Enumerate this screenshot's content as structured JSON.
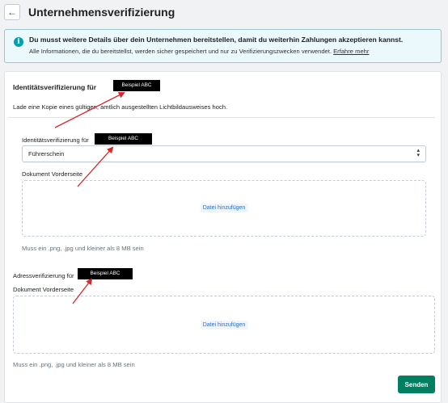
{
  "header": {
    "back_icon": "arrow-left-icon",
    "back_glyph": "←",
    "title": "Unternehmensverifizierung"
  },
  "banner": {
    "icon": "info-icon",
    "icon_glyph": "i",
    "title": "Du musst weitere Details über dein Unternehmen bereitstellen, damit du weiterhin Zahlungen akzeptieren kannst.",
    "body": "Alle Informationen, die du bereitstellst, werden sicher gespeichert und nur zu Verifizierungszwecken verwendet.",
    "link": "Erfahre mehr"
  },
  "identity": {
    "title": "Identitätsverifizierung für",
    "redacted_label": "Beispiel ABC",
    "description": "Lade eine Kopie eines gültigen, amtlich ausgestellten Lichtbildausweises hoch.",
    "select_label": "Identitätsverifizierung für",
    "select_label_redacted": "Beispiel ABC",
    "select_value": "Führerschein",
    "select_arrows": "▲▼",
    "doc_label": "Dokument Vorderseite",
    "add_file": "Datei hinzufügen",
    "hint": "Muss ein .png, .jpg und kleiner als 8 MB sein"
  },
  "address": {
    "title": "Adressverifizierung für",
    "redacted_label": "Beispiel ABC",
    "doc_label": "Dokument Vorderseite",
    "add_file": "Datei hinzufügen",
    "hint": "Muss ein .png, .jpg und kleiner als 8 MB sein"
  },
  "footer": {
    "submit": "Senden"
  },
  "colors": {
    "annotation_arrow": "#d9262b",
    "primary_button": "#008060",
    "banner_bg": "#ebf9fc"
  }
}
